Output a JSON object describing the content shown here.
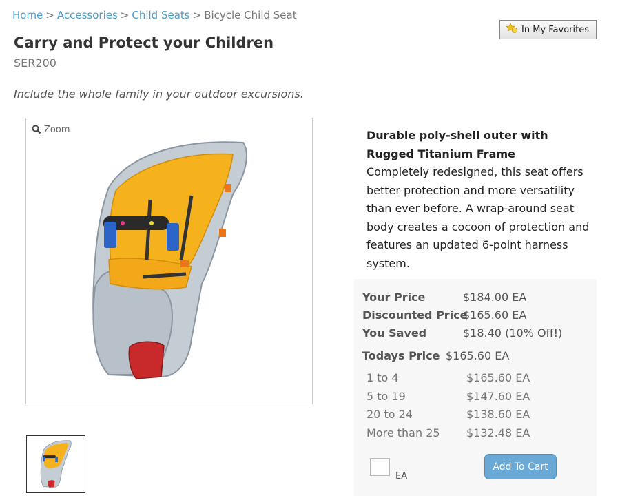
{
  "breadcrumb": {
    "items": [
      "Home",
      "Accessories",
      "Child Seats"
    ],
    "current": "Bicycle Child Seat",
    "separator": ">"
  },
  "favorites": {
    "label": "In My Favorites",
    "icon": "favorites-star-icon"
  },
  "product": {
    "title": "Carry and Protect your Children",
    "sku": "SER200",
    "tagline": "Include the whole family in your outdoor excursions.",
    "zoom_label": "Zoom",
    "description_heading": "Durable poly-shell outer with Rugged Titanium Frame",
    "description": "Completely redesigned, this seat offers better protection and more versatility than ever before. A wrap-around seat body creates a cocoon of protection and features an updated 6-point harness system."
  },
  "pricing": {
    "your_price_label": "Your Price",
    "your_price": "$184.00 EA",
    "discounted_label": "Discounted Price",
    "discounted": "$165.60 EA",
    "saved_label": "You Saved",
    "saved": "$18.40 (10% Off!)",
    "today_label": "Todays Price",
    "today": "$165.60 EA",
    "tiers": [
      {
        "range": "1 to 4",
        "price": "$165.60 EA"
      },
      {
        "range": "5 to 19",
        "price": "$147.60 EA"
      },
      {
        "range": "20 to 24",
        "price": "$138.60 EA"
      },
      {
        "range": "More than 25",
        "price": "$132.48 EA"
      }
    ]
  },
  "cart": {
    "unit": "EA",
    "button": "Add To Cart",
    "quantity": ""
  },
  "colors": {
    "link": "#4a9dc9",
    "button": "#6aa9d6",
    "seat_shell": "#c4ccd4",
    "seat_padding": "#f5b21c"
  }
}
